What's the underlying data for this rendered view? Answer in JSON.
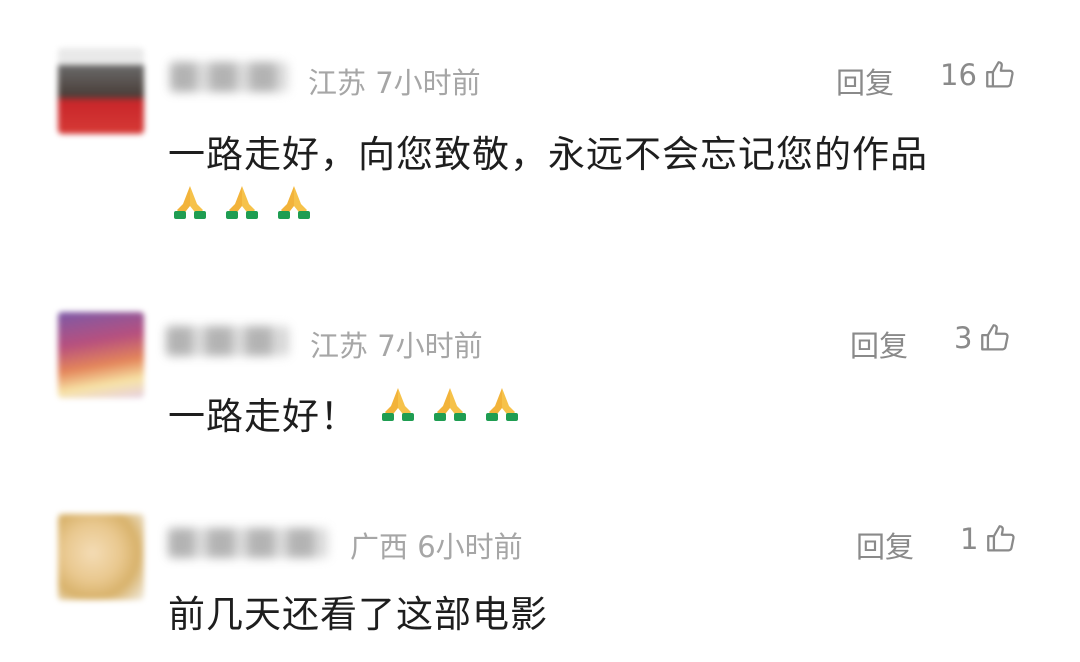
{
  "comments": [
    {
      "region": "江苏",
      "time": "7小时前",
      "reply_label": "回复",
      "likes": "16",
      "text": "一路走好，向您致敬，永远不会忘记您的作品",
      "emoji_count": 3,
      "emoji": "folded-hands"
    },
    {
      "region": "江苏",
      "time": "7小时前",
      "reply_label": "回复",
      "likes": "3",
      "text": "一路走好！",
      "emoji_count": 3,
      "emoji": "folded-hands"
    },
    {
      "region": "广西",
      "time": "6小时前",
      "reply_label": "回复",
      "likes": "1",
      "text": "前几天还看了这部电影",
      "emoji_count": 0
    }
  ],
  "colors": {
    "meta": "#a6a6a6",
    "action": "#8a8a8a",
    "body_text": "#1e1e1e",
    "emoji_hands": "#f2b33a",
    "emoji_sleeve": "#1f9d52"
  }
}
